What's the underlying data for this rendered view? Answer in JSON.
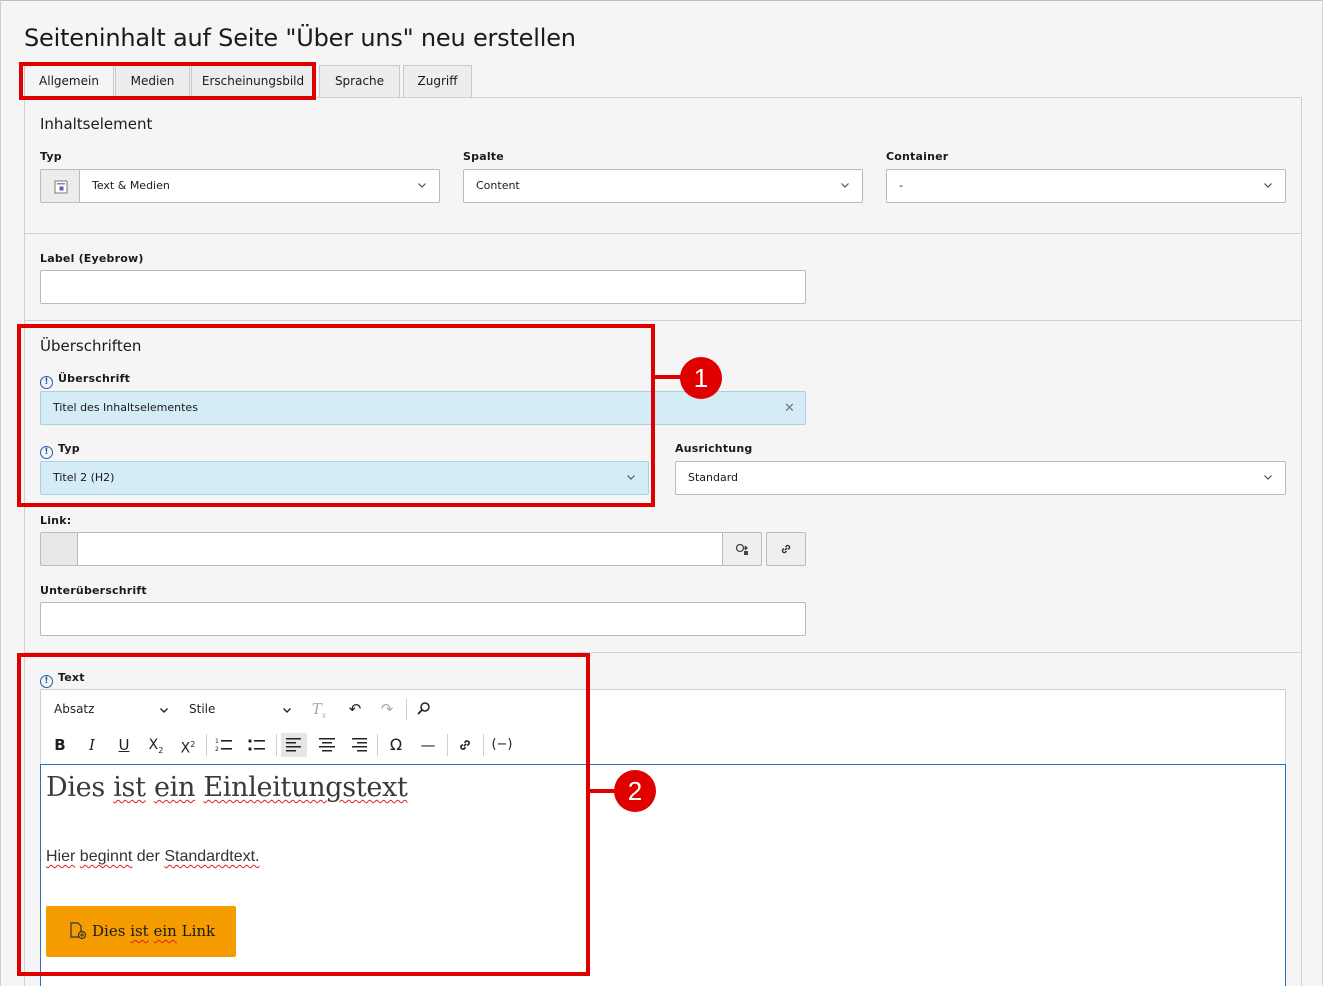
{
  "page": {
    "title": "Seiteninhalt auf Seite \"Über uns\" neu erstellen"
  },
  "tabs": [
    "Allgemein",
    "Medien",
    "Erscheinungsbild",
    "Sprache",
    "Zugriff"
  ],
  "active_tab": "Allgemein",
  "inhaltselement": {
    "section_title": "Inhaltselement",
    "typ": {
      "label": "Typ",
      "value": "Text & Medien"
    },
    "spalte": {
      "label": "Spalte",
      "value": "Content"
    },
    "container": {
      "label": "Container",
      "value": "-"
    }
  },
  "eyebrow": {
    "label": "Label (Eyebrow)",
    "value": ""
  },
  "ueberschriften": {
    "section_title": "Überschriften",
    "ueberschrift": {
      "label": "Überschrift",
      "value": "Titel des Inhaltselementes"
    },
    "typ": {
      "label": "Typ",
      "value": "Titel 2 (H2)"
    },
    "ausrichtung": {
      "label": "Ausrichtung",
      "value": "Standard"
    },
    "link": {
      "label": "Link:",
      "value": ""
    },
    "unterueberschrift": {
      "label": "Unterüberschrift",
      "value": ""
    }
  },
  "text_field": {
    "label": "Text",
    "toolbar": {
      "format": "Absatz",
      "style": "Stile"
    },
    "content": {
      "heading": [
        "Dies",
        "ist",
        "ein",
        "Einleitungstext"
      ],
      "paragraph": [
        "Hier",
        "beginnt",
        "der",
        "Standardtext."
      ],
      "button": [
        "Dies",
        "ist",
        "ein",
        "Link"
      ]
    }
  },
  "callouts": [
    "1",
    "2"
  ],
  "colors": {
    "highlight_field": "#d3ecf6",
    "annotation_red": "#e00000",
    "link_button": "#f59c00",
    "editor_focus": "#2c6fbf"
  },
  "icons": [
    "content-type-icon",
    "chevron-down-icon",
    "info-icon",
    "clear-icon",
    "link-browser-icon",
    "link-icon",
    "clear-format-icon",
    "undo-icon",
    "redo-icon",
    "find-replace-icon",
    "bold-icon",
    "italic-icon",
    "underline-icon",
    "subscript-icon",
    "superscript-icon",
    "numbered-list-icon",
    "bulleted-list-icon",
    "align-left-icon",
    "align-center-icon",
    "align-right-icon",
    "special-char-icon",
    "horizontal-line-icon",
    "insert-link-icon",
    "placeholder-icon",
    "file-link-icon"
  ]
}
